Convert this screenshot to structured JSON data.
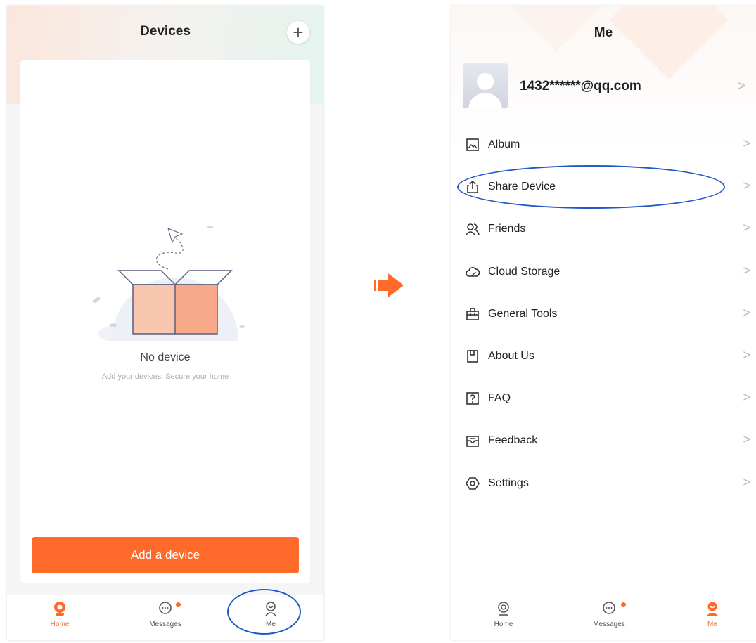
{
  "left_screen": {
    "title": "Devices",
    "add_icon": "plus-icon",
    "empty_state": {
      "title": "No device",
      "subtitle": "Add your devices, Secure your home",
      "illustration": "empty-box-illustration"
    },
    "add_button_label": "Add a device",
    "tabs": [
      {
        "label": "Home",
        "icon": "camera-icon",
        "active": true
      },
      {
        "label": "Messages",
        "icon": "chat-bubble-icon",
        "badge": true
      },
      {
        "label": "Me",
        "icon": "user-icon",
        "highlighted": true
      }
    ]
  },
  "right_screen": {
    "title": "Me",
    "profile": {
      "email": "1432******@qq.com",
      "avatar": "default-avatar"
    },
    "menu": [
      {
        "label": "Album",
        "icon": "image-icon",
        "highlighted": false
      },
      {
        "label": "Share Device",
        "icon": "share-icon",
        "highlighted": true
      },
      {
        "label": "Friends",
        "icon": "friends-icon"
      },
      {
        "label": "Cloud Storage",
        "icon": "cloud-icon"
      },
      {
        "label": "General Tools",
        "icon": "toolbox-icon"
      },
      {
        "label": "About Us",
        "icon": "bookmark-icon"
      },
      {
        "label": "FAQ",
        "icon": "question-icon"
      },
      {
        "label": "Feedback",
        "icon": "feedback-icon"
      },
      {
        "label": "Settings",
        "icon": "settings-icon"
      }
    ],
    "tabs": [
      {
        "label": "Home",
        "icon": "camera-icon"
      },
      {
        "label": "Messages",
        "icon": "chat-bubble-icon",
        "badge": true
      },
      {
        "label": "Me",
        "icon": "user-icon",
        "active": true
      }
    ]
  },
  "colors": {
    "accent": "#ff6a2b",
    "highlight_ellipse": "#1f5bc7",
    "chevron": "#b9b9b9"
  }
}
